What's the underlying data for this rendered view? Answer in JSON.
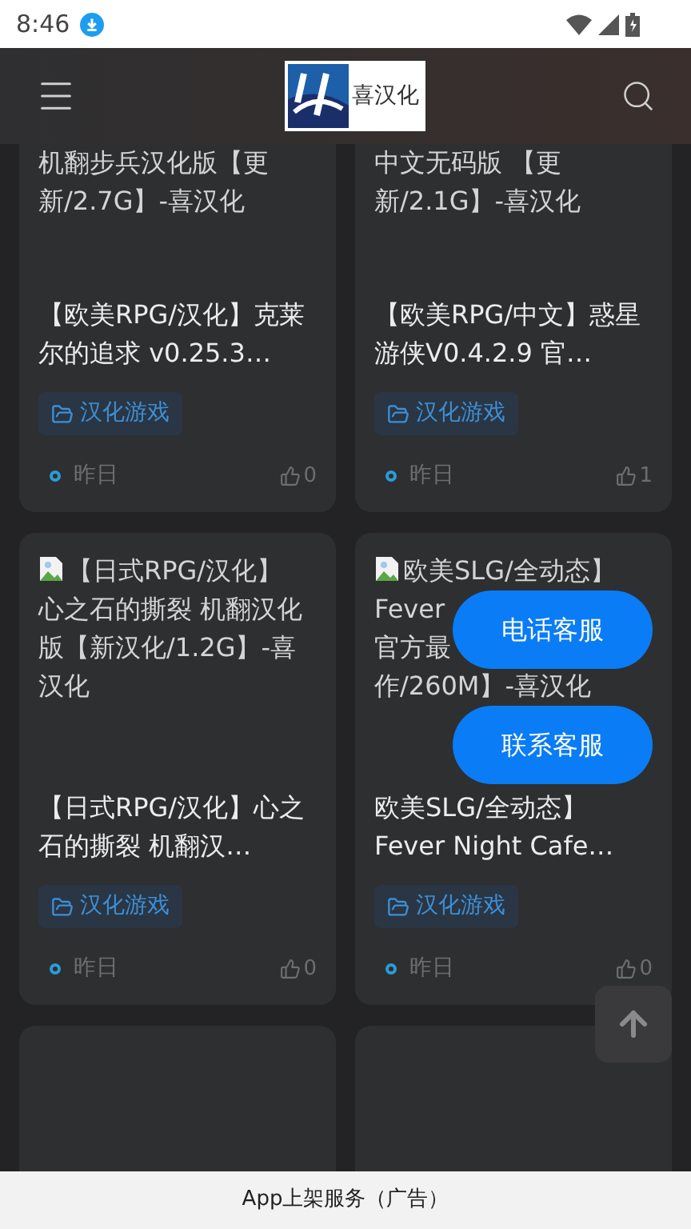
{
  "status_bar": {
    "time": "8:46"
  },
  "header": {
    "logo_text": "喜汉化"
  },
  "rows": [
    {
      "cards": [
        {
          "alt_lines": [
            "机翻步兵汉化版【更",
            "新/2.7G】-喜汉化"
          ],
          "title": "【欧美RPG/汉化】克莱尔的追求 v0.25.3…",
          "tag": "汉化游戏",
          "time": "昨日",
          "likes": "0"
        },
        {
          "alt_lines": [
            "中文无码版 【更",
            "新/2.1G】-喜汉化"
          ],
          "title": "【欧美RPG/中文】惑星游侠V0.4.2.9 官…",
          "tag": "汉化游戏",
          "time": "昨日",
          "likes": "1"
        }
      ]
    },
    {
      "cards": [
        {
          "alt_lines": [
            "【日式RPG/汉化】",
            "心之石的撕裂 机翻汉化",
            "版【新汉化/1.2G】-喜",
            "汉化"
          ],
          "title": "【日式RPG/汉化】心之石的撕裂 机翻汉…",
          "tag": "汉化游戏",
          "time": "昨日",
          "likes": "0"
        },
        {
          "alt_lines": [
            "欧美SLG/全动态】",
            "Fever",
            "官方最",
            "作/260M】-喜汉化"
          ],
          "title": "欧美SLG/全动态】Fever Night Cafe…",
          "tag": "汉化游戏",
          "time": "昨日",
          "likes": "0"
        }
      ]
    },
    {
      "cards": [
        {
          "kind": "empty"
        },
        {
          "kind": "empty"
        }
      ]
    }
  ],
  "floating_buttons": [
    "电话客服",
    "联系客服"
  ],
  "ad_bar": {
    "text": "App上架服务（广告）"
  }
}
